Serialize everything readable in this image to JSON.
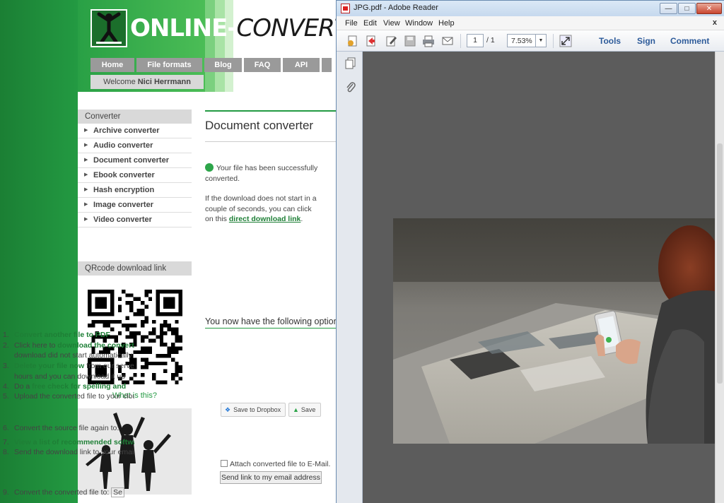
{
  "site": {
    "logo_text_left": "ONLINE-",
    "logo_text_right": "CONVERT",
    "nav": [
      "Home",
      "File formats",
      "Blog",
      "FAQ",
      "API"
    ],
    "welcome_prefix": "Welcome",
    "welcome_user": "Nici Herrmann",
    "sidebar_heading": "Converter",
    "sidebar_items": [
      "Archive converter",
      "Audio converter",
      "Document converter",
      "Ebook converter",
      "Hash encryption",
      "Image converter",
      "Video converter"
    ],
    "qr_heading": "QRcode download link",
    "qr_link": "What is this?",
    "main_title": "Document converter",
    "success_text": "Your file has been successfully converted.",
    "download_text": "If the download does not start in a couple of seconds, you can click on this",
    "download_link": "direct download link",
    "download_period": ".",
    "options_title": "You now have the following options:",
    "options": [
      {
        "n": "1.",
        "text": "Convert another file to PDF",
        "green": true
      },
      {
        "n": "2.",
        "prefix": "Click here to ",
        "link": "download the converted file",
        "green": false
      },
      {
        "n": "",
        "text": "download did not start automatically",
        "green": false
      },
      {
        "n": "3.",
        "link": "Delete your file now",
        "suffix": " from our server",
        "green": false
      },
      {
        "n": "",
        "text": "hours and you can download it up",
        "green": false
      },
      {
        "n": "4.",
        "prefix": "Do a ",
        "link": "free check for spelling and",
        "green": false
      },
      {
        "n": "5.",
        "text": "Upload the converted file to your cloud",
        "green": false
      },
      {
        "n": "6.",
        "text": "Convert the source file again to:",
        "green": false
      },
      {
        "n": "7.",
        "text": "View a list of recommended software",
        "green": true
      },
      {
        "n": "8.",
        "text": "Send the download link to your email",
        "green": false
      },
      {
        "n": "9.",
        "text": "Convert the converted file to:",
        "green": false
      }
    ],
    "dropbox_label": "Save to Dropbox",
    "drive_label": "Save",
    "attach_label": "Attach converted file to E-Mail.",
    "email_button": "Send link to my email address",
    "select_stub": "Se"
  },
  "reader": {
    "title": "JPG.pdf - Adobe Reader",
    "window_controls": {
      "minimize": "—",
      "maximize": "□",
      "close": "✕"
    },
    "menu": [
      "File",
      "Edit",
      "View",
      "Window",
      "Help"
    ],
    "menu_close": "x",
    "page_current": "1",
    "page_total": "/ 1",
    "zoom": "7.53%",
    "tools": "Tools",
    "sign": "Sign",
    "comment": "Comment",
    "colors": {
      "doc_bg": "#5c5c5c",
      "link_blue": "#2d5b9a"
    }
  }
}
